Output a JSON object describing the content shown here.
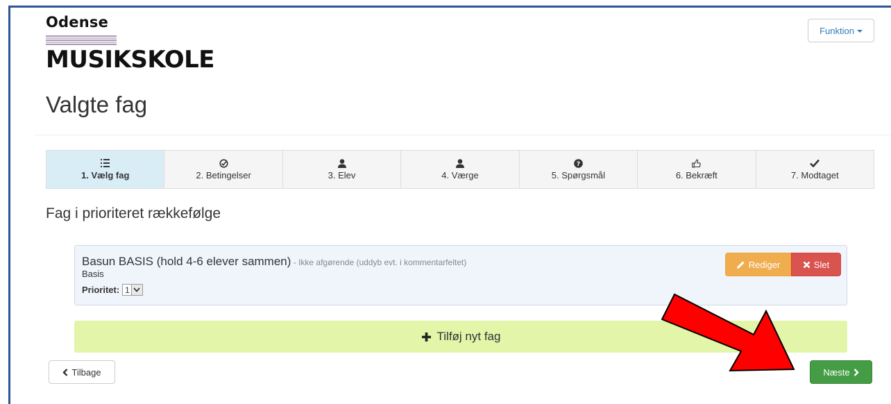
{
  "header": {
    "logo_top": "Odense",
    "logo_bottom": "MUSIKSKOLE",
    "function_button": "Funktion"
  },
  "page": {
    "title": "Valgte fag",
    "section_title": "Fag i prioriteret rækkefølge"
  },
  "steps": [
    {
      "label": "1. Vælg fag",
      "icon": "list-icon",
      "active": true
    },
    {
      "label": "2. Betingelser",
      "icon": "check-circle-icon",
      "active": false
    },
    {
      "label": "3. Elev",
      "icon": "user-icon",
      "active": false
    },
    {
      "label": "4. Værge",
      "icon": "user-icon",
      "active": false
    },
    {
      "label": "5. Spørgsmål",
      "icon": "question-icon",
      "active": false
    },
    {
      "label": "6. Bekræft",
      "icon": "thumbs-up-icon",
      "active": false
    },
    {
      "label": "7. Modtaget",
      "icon": "checkmark-icon",
      "active": false
    }
  ],
  "subject": {
    "name": "Basun BASIS (hold 4-6 elever sammen)",
    "note": " - Ikke afgørende (uddyb evt. i kommentarfeltet)",
    "level": "Basis",
    "priority_label": "Prioritet:",
    "priority_value": "1",
    "edit_label": "Rediger",
    "delete_label": "Slet"
  },
  "actions": {
    "add_subject": "Tilføj nyt fag",
    "back": "Tilbage",
    "next": "Næste"
  },
  "colors": {
    "frame": "#2f5597",
    "active_step": "#d9edf7",
    "edit": "#f0ad4e",
    "delete": "#d9534f",
    "add_bar": "#e2f5a8",
    "next": "#449d44",
    "arrow": "#ff0000"
  }
}
